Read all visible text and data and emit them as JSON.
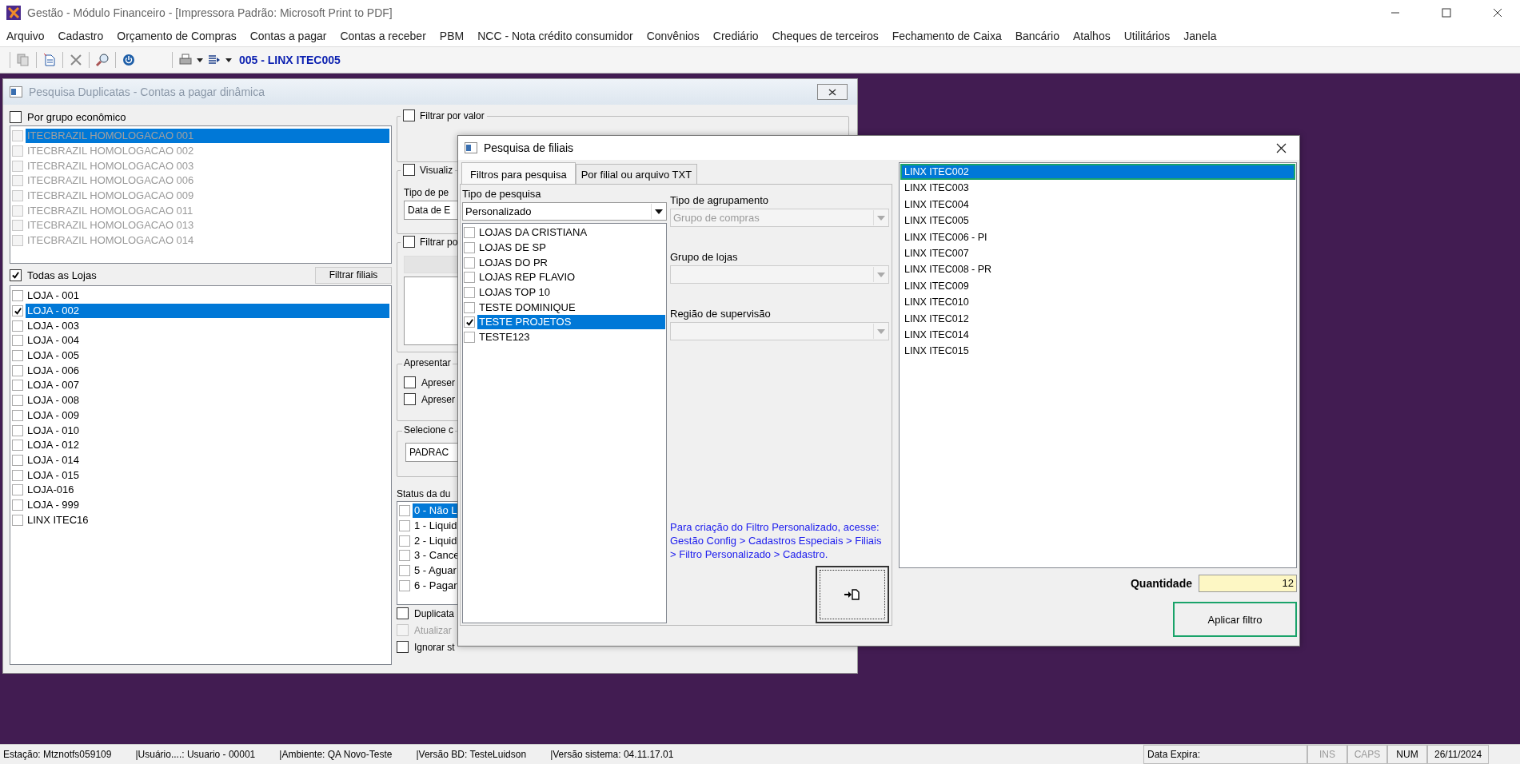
{
  "app": {
    "title": "Gestão  - Módulo Financeiro - [Impressora Padrão: Microsoft Print to PDF]",
    "menu": [
      "Arquivo",
      "Cadastro",
      "Orçamento de Compras",
      "Contas a pagar",
      "Contas a receber",
      "PBM",
      "NCC - Nota crédito consumidor",
      "Convênios",
      "Crediário",
      "Cheques de terceiros",
      "Fechamento de Caixa",
      "Bancário",
      "Atalhos",
      "Utilitários",
      "Janela"
    ],
    "toolbar_label": "005 - LINX ITEC005"
  },
  "window": {
    "title": "Pesquisa Duplicatas - Contas a pagar dinâmica",
    "group_check": {
      "label": "Por grupo econômico",
      "checked": false
    },
    "groups_enabled": false,
    "groups": [
      {
        "label": "ITECBRAZIL HOMOLOGACAO 001",
        "checked": false,
        "selected": true
      },
      {
        "label": "ITECBRAZIL HOMOLOGACAO 002",
        "checked": false,
        "selected": false
      },
      {
        "label": "ITECBRAZIL HOMOLOGACAO 003",
        "checked": false,
        "selected": false
      },
      {
        "label": "ITECBRAZIL HOMOLOGACAO 006",
        "checked": false,
        "selected": false
      },
      {
        "label": "ITECBRAZIL HOMOLOGACAO 009",
        "checked": false,
        "selected": false
      },
      {
        "label": "ITECBRAZIL HOMOLOGACAO 011",
        "checked": false,
        "selected": false
      },
      {
        "label": "ITECBRAZIL HOMOLOGACAO 013",
        "checked": false,
        "selected": false
      },
      {
        "label": "ITECBRAZIL HOMOLOGACAO 014",
        "checked": false,
        "selected": false
      }
    ],
    "all_stores": {
      "label": "Todas as Lojas",
      "checked": true
    },
    "filter_button": "Filtrar filiais",
    "stores": [
      {
        "label": "LOJA - 001",
        "checked": false,
        "selected": false
      },
      {
        "label": "LOJA - 002",
        "checked": true,
        "selected": true
      },
      {
        "label": "LOJA - 003",
        "checked": false,
        "selected": false
      },
      {
        "label": "LOJA - 004",
        "checked": false,
        "selected": false
      },
      {
        "label": "LOJA - 005",
        "checked": false,
        "selected": false
      },
      {
        "label": "LOJA - 006",
        "checked": false,
        "selected": false
      },
      {
        "label": "LOJA - 007",
        "checked": false,
        "selected": false
      },
      {
        "label": "LOJA - 008",
        "checked": false,
        "selected": false
      },
      {
        "label": "LOJA - 009",
        "checked": false,
        "selected": false
      },
      {
        "label": "LOJA - 010",
        "checked": false,
        "selected": false
      },
      {
        "label": "LOJA - 012",
        "checked": false,
        "selected": false
      },
      {
        "label": "LOJA - 014",
        "checked": false,
        "selected": false
      },
      {
        "label": "LOJA - 015",
        "checked": false,
        "selected": false
      },
      {
        "label": "LOJA-016",
        "checked": false,
        "selected": false
      },
      {
        "label": "LOJA - 999",
        "checked": false,
        "selected": false
      },
      {
        "label": "LINX ITEC16",
        "checked": false,
        "selected": false
      }
    ],
    "filter_value": {
      "label": "Filtrar por valor",
      "checked": false
    },
    "visualize": {
      "label": "Visualiz",
      "checked": false,
      "type_label": "Tipo de pe",
      "type_value": "Data de E"
    },
    "filter_by": {
      "label": "Filtrar po",
      "checked": false
    },
    "present": {
      "title": "Apresentar",
      "options": [
        {
          "label": "Apreser",
          "checked": false
        },
        {
          "label": "Apreser",
          "checked": false
        }
      ]
    },
    "select": {
      "title": "Selecione c",
      "value": "PADRAC"
    },
    "status": {
      "title": "Status da du",
      "items": [
        {
          "label": "0 - Não L",
          "checked": false,
          "selected": true
        },
        {
          "label": "1 - Liquid",
          "checked": false,
          "selected": false
        },
        {
          "label": "2 - Liquid",
          "checked": false,
          "selected": false
        },
        {
          "label": "3 - Cance",
          "checked": false,
          "selected": false
        },
        {
          "label": "5 - Aguar",
          "checked": false,
          "selected": false
        },
        {
          "label": "6 - Pagar",
          "checked": false,
          "selected": false
        }
      ]
    },
    "extra_checks": [
      {
        "label": "Duplicata",
        "checked": false,
        "disabled": false
      },
      {
        "label": "Atualizar",
        "checked": false,
        "disabled": true
      },
      {
        "label": "Ignorar st",
        "checked": false,
        "disabled": false
      }
    ]
  },
  "dialog": {
    "title": "Pesquisa de filiais",
    "tabs": [
      {
        "label": "Filtros para pesquisa",
        "selected": true
      },
      {
        "label": "Por filial ou arquivo TXT",
        "selected": false
      }
    ],
    "search_type": {
      "label": "Tipo de pesquisa",
      "value": "Personalizado"
    },
    "filters": [
      {
        "label": "LOJAS DA CRISTIANA",
        "checked": false,
        "selected": false
      },
      {
        "label": "LOJAS DE SP",
        "checked": false,
        "selected": false
      },
      {
        "label": "LOJAS DO PR",
        "checked": false,
        "selected": false
      },
      {
        "label": "LOJAS REP FLAVIO",
        "checked": false,
        "selected": false
      },
      {
        "label": "LOJAS TOP 10",
        "checked": false,
        "selected": false
      },
      {
        "label": "TESTE DOMINIQUE",
        "checked": false,
        "selected": false
      },
      {
        "label": "TESTE PROJETOS",
        "checked": true,
        "selected": true
      },
      {
        "label": "TESTE123",
        "checked": false,
        "selected": false
      }
    ],
    "combos": [
      {
        "label": "Tipo de agrupamento",
        "value": "Grupo de compras",
        "disabled": true
      },
      {
        "label": "Grupo de lojas",
        "disabled": true
      },
      {
        "label": "Região de supervisão",
        "disabled": true
      }
    ],
    "help_text": "Para criação do Filtro Personalizado, acesse: Gestão Config > Cadastros Especiais > Filiais > Filtro Personalizado > Cadastro.",
    "results": [
      {
        "label": "LINX ITEC002",
        "selected": true
      },
      {
        "label": "LINX ITEC003",
        "selected": false
      },
      {
        "label": "LINX ITEC004",
        "selected": false
      },
      {
        "label": "LINX ITEC005",
        "selected": false
      },
      {
        "label": "LINX ITEC006 - PI",
        "selected": false
      },
      {
        "label": "LINX ITEC007",
        "selected": false
      },
      {
        "label": "LINX ITEC008 - PR",
        "selected": false
      },
      {
        "label": "LINX ITEC009",
        "selected": false
      },
      {
        "label": "LINX ITEC010",
        "selected": false
      },
      {
        "label": "LINX ITEC012",
        "selected": false
      },
      {
        "label": "LINX ITEC014",
        "selected": false
      },
      {
        "label": "LINX ITEC015",
        "selected": false
      }
    ],
    "quantity": {
      "label": "Quantidade",
      "value": "12"
    },
    "apply_button": "Aplicar filtro"
  },
  "status_bar": {
    "items": [
      "Estação: Mtznotfs059109",
      "|Usuário....: Usuario - 00001",
      "|Ambiente: QA Novo-Teste",
      "|Versão BD: TesteLuidson",
      "|Versão sistema: 04.11.17.01"
    ],
    "expiry": "Data Expira:",
    "keys": [
      {
        "label": "INS",
        "on": false
      },
      {
        "label": "CAPS",
        "on": false
      },
      {
        "label": "NUM",
        "on": true
      }
    ],
    "date": "26/11/2024"
  }
}
